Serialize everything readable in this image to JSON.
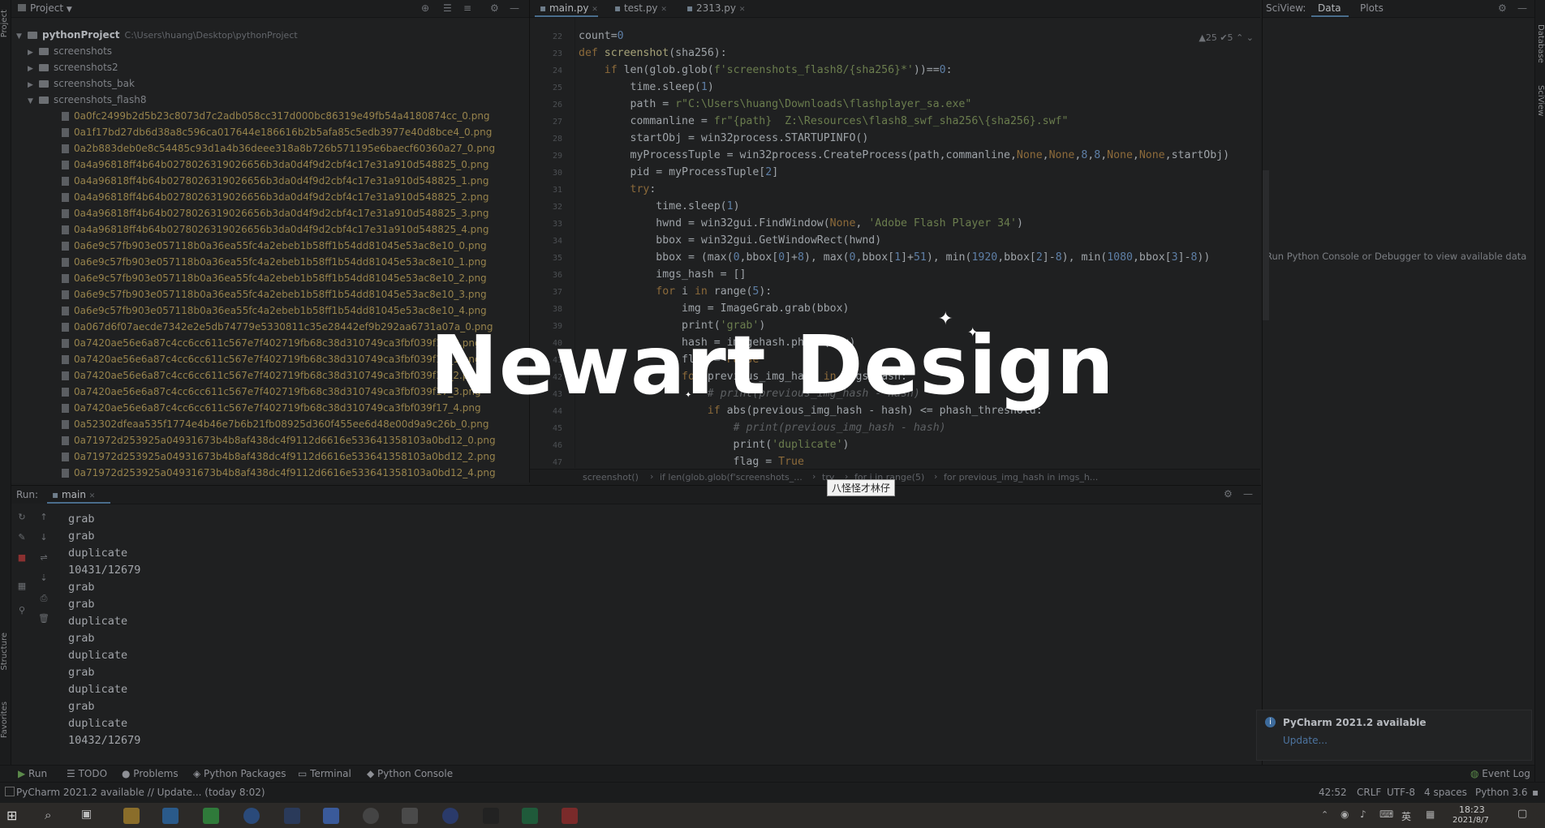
{
  "project_pane": {
    "title": "Project",
    "root_name": "pythonProject",
    "root_path": "C:\\Users\\huang\\Desktop\\pythonProject",
    "folders": [
      "screenshots",
      "screenshots2",
      "screenshots_bak",
      "screenshots_flash8"
    ],
    "files": [
      "0a0fc2499b2d5b23c8073d7c2adb058cc317d000bc86319e49fb54a4180874cc_0.png",
      "0a1f17bd27db6d38a8c596ca017644e186616b2b5afa85c5edb3977e40d8bce4_0.png",
      "0a2b883deb0e8c54485c93d1a4b36deee318a8b726b571195e6baecf60360a27_0.png",
      "0a4a96818ff4b64b0278026319026656b3da0d4f9d2cbf4c17e31a910d548825_0.png",
      "0a4a96818ff4b64b0278026319026656b3da0d4f9d2cbf4c17e31a910d548825_1.png",
      "0a4a96818ff4b64b0278026319026656b3da0d4f9d2cbf4c17e31a910d548825_2.png",
      "0a4a96818ff4b64b0278026319026656b3da0d4f9d2cbf4c17e31a910d548825_3.png",
      "0a4a96818ff4b64b0278026319026656b3da0d4f9d2cbf4c17e31a910d548825_4.png",
      "0a6e9c57fb903e057118b0a36ea55fc4a2ebeb1b58ff1b54dd81045e53ac8e10_0.png",
      "0a6e9c57fb903e057118b0a36ea55fc4a2ebeb1b58ff1b54dd81045e53ac8e10_1.png",
      "0a6e9c57fb903e057118b0a36ea55fc4a2ebeb1b58ff1b54dd81045e53ac8e10_2.png",
      "0a6e9c57fb903e057118b0a36ea55fc4a2ebeb1b58ff1b54dd81045e53ac8e10_3.png",
      "0a6e9c57fb903e057118b0a36ea55fc4a2ebeb1b58ff1b54dd81045e53ac8e10_4.png",
      "0a067d6f07aecde7342e2e5db74779e5330811c35e28442ef9b292aa6731a07a_0.png",
      "0a7420ae56e6a87c4cc6cc611c567e7f402719fb68c38d310749ca3fbf039f17_0.png",
      "0a7420ae56e6a87c4cc6cc611c567e7f402719fb68c38d310749ca3fbf039f17_1.png",
      "0a7420ae56e6a87c4cc6cc611c567e7f402719fb68c38d310749ca3fbf039f17_2.png",
      "0a7420ae56e6a87c4cc6cc611c567e7f402719fb68c38d310749ca3fbf039f17_3.png",
      "0a7420ae56e6a87c4cc6cc611c567e7f402719fb68c38d310749ca3fbf039f17_4.png",
      "0a52302dfeaa535f1774e4b46e7b6b21fb08925d360f455ee6d48e00d9a9c26b_0.png",
      "0a71972d253925a04931673b4b8af438dc4f9112d6616e533641358103a0bd12_0.png",
      "0a71972d253925a04931673b4b8af438dc4f9112d6616e533641358103a0bd12_2.png",
      "0a71972d253925a04931673b4b8af438dc4f9112d6616e533641358103a0bd12_4.png"
    ]
  },
  "editor": {
    "tabs": [
      "main.py",
      "test.py",
      "2313.py"
    ],
    "inspection": "▲25  ✔5",
    "line_numbers": [
      "22",
      "23",
      "24",
      "25",
      "26",
      "27",
      "28",
      "29",
      "30",
      "31",
      "32",
      "33",
      "34",
      "35",
      "36",
      "37",
      "38",
      "39",
      "40",
      "41",
      "42",
      "43",
      "44",
      "45",
      "46",
      "47"
    ],
    "breadcrumb": [
      "screenshot()",
      "if len(glob.glob(f'screenshots_...",
      "try",
      "for i in range(5)",
      "for previous_img_hash in imgs_h..."
    ]
  },
  "sciview": {
    "title": "SciView:",
    "tabs": [
      "Data",
      "Plots"
    ],
    "empty_message": "Run Python Console or Debugger to view available data",
    "side_labels": [
      "Database",
      "SciView"
    ]
  },
  "run_panel": {
    "label": "Run:",
    "config": "main",
    "output": [
      "grab",
      "grab",
      "duplicate",
      "10431/12679",
      "grab",
      "grab",
      "duplicate",
      "grab",
      "duplicate",
      "grab",
      "duplicate",
      "grab",
      "duplicate",
      "10432/12679"
    ]
  },
  "notification": {
    "title": "PyCharm 2021.2 available",
    "link": "Update..."
  },
  "bottom_tabs": [
    "Run",
    "TODO",
    "Problems",
    "Python Packages",
    "Terminal",
    "Python Console"
  ],
  "event_log": "Event Log",
  "status": {
    "message": "PyCharm 2021.2 available // Update... (today 8:02)",
    "position": "42:52",
    "line_sep": "CRLF",
    "encoding": "UTF-8",
    "indent": "4 spaces",
    "interpreter": "Python 3.6"
  },
  "left_strip_labels": [
    "Project",
    "Structure",
    "Favorites"
  ],
  "taskbar": {
    "time": "18:23",
    "date": "2021/8/7",
    "ime": "英"
  },
  "overlay": {
    "watermark": "Newart Design",
    "label": "八怪怪才林仔"
  },
  "colors": {
    "background": "#1f2021",
    "keyword": "#8c6a3a",
    "string": "#6b7d4e",
    "number": "#5e7fa6",
    "accent": "#4a6d8c"
  }
}
